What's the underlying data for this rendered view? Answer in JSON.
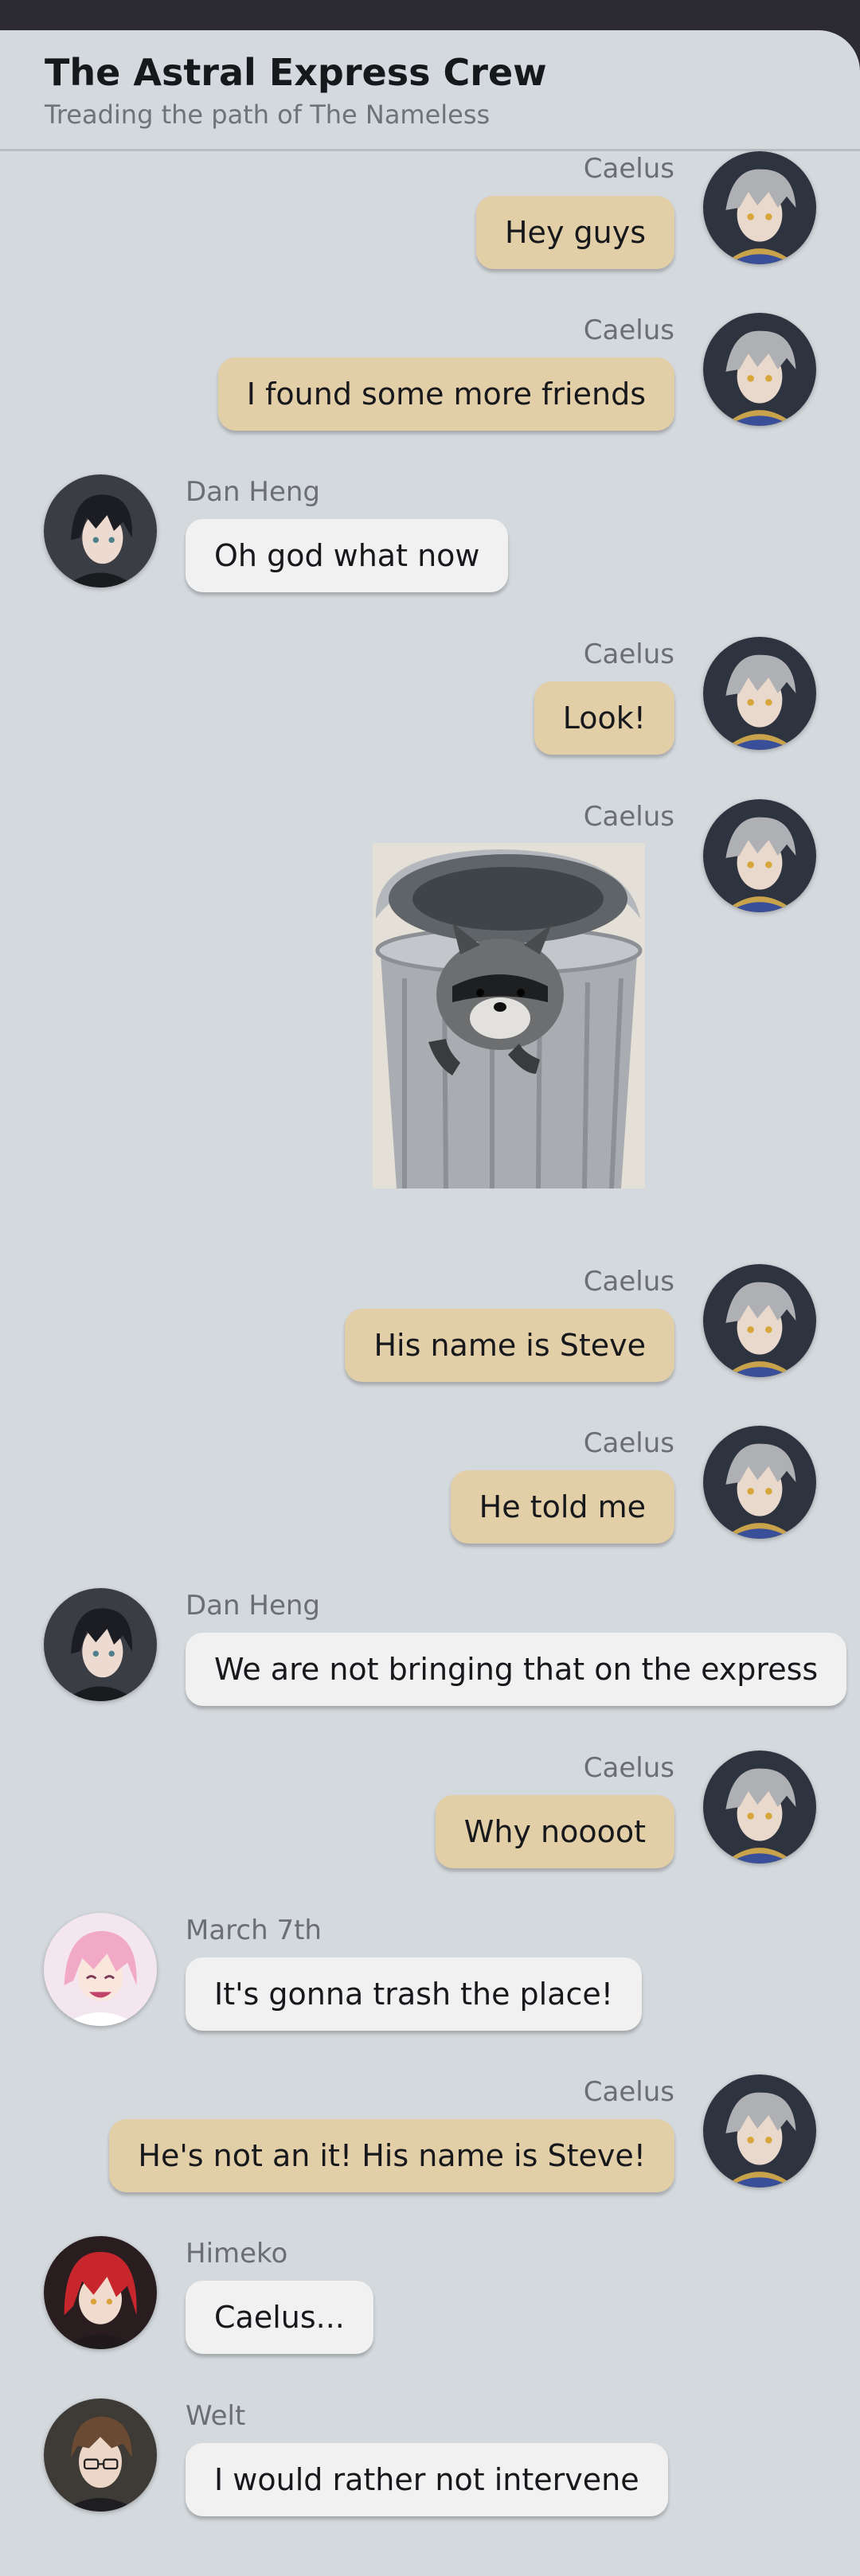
{
  "chat": {
    "title": "The Astral Express Crew",
    "subtitle": "Treading the path of The Nameless"
  },
  "messages": [
    {
      "sender": "Caelus",
      "side": "right",
      "text": "Hey guys",
      "avatar": "caelus-avatar"
    },
    {
      "sender": "Caelus",
      "side": "right",
      "text": "I found some more friends",
      "avatar": "caelus-avatar"
    },
    {
      "sender": "Dan Heng",
      "side": "left",
      "text": "Oh god what now",
      "avatar": "dan-heng-avatar"
    },
    {
      "sender": "Caelus",
      "side": "right",
      "text": "Look!",
      "avatar": "caelus-avatar"
    },
    {
      "sender": "Caelus",
      "side": "right",
      "image": "raccoon-in-trash-can-photo",
      "avatar": "caelus-avatar"
    },
    {
      "sender": "Caelus",
      "side": "right",
      "text": "His name is Steve",
      "avatar": "caelus-avatar"
    },
    {
      "sender": "Caelus",
      "side": "right",
      "text": "He told me",
      "avatar": "caelus-avatar"
    },
    {
      "sender": "Dan Heng",
      "side": "left",
      "text": "We are not bringing that on the express",
      "avatar": "dan-heng-avatar"
    },
    {
      "sender": "Caelus",
      "side": "right",
      "text": "Why noooot",
      "avatar": "caelus-avatar"
    },
    {
      "sender": "March 7th",
      "side": "left",
      "text": "It's gonna trash the place!",
      "avatar": "march-7th-avatar"
    },
    {
      "sender": "Caelus",
      "side": "right",
      "text": "He's not an it! His name is Steve!",
      "avatar": "caelus-avatar"
    },
    {
      "sender": "Himeko",
      "side": "left",
      "text": "Caelus...",
      "avatar": "himeko-avatar"
    },
    {
      "sender": "Welt",
      "side": "left",
      "text": "I would rather not intervene",
      "avatar": "welt-avatar"
    }
  ],
  "colors": {
    "own_bubble": "#e2cea7",
    "other_bubble": "#f1f1f1",
    "background": "#d4d9dd",
    "top_bar": "#2c2b31"
  }
}
